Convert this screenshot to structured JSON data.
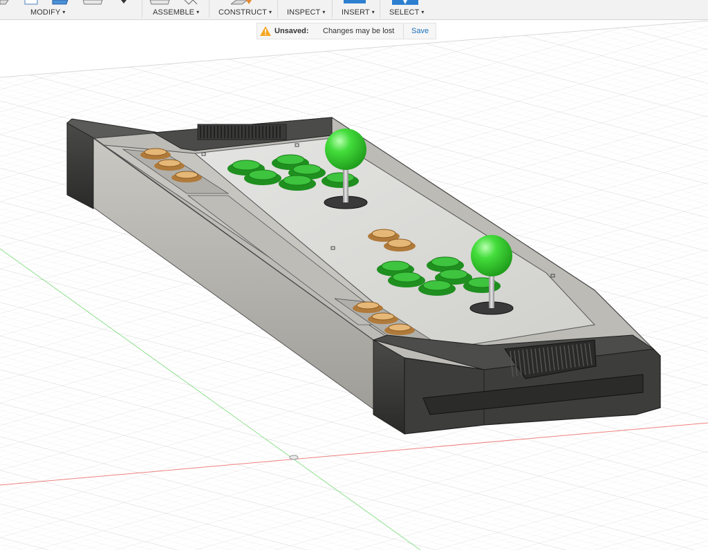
{
  "toolbar": {
    "modify": "MODIFY",
    "assemble": "ASSEMBLE",
    "construct": "CONSTRUCT",
    "inspect": "INSPECT",
    "insert": "INSERT",
    "select": "SELECT",
    "caret": "▾"
  },
  "notification": {
    "title": "Unsaved:",
    "message": "Changes may be lost",
    "save_label": "Save",
    "icon": "warning-icon"
  },
  "model": {
    "name": "arcade fight stick enclosure",
    "button_colors": {
      "action": "#3fbf3f",
      "start": "#e0b070",
      "joystick_ball": "#33cc33"
    }
  }
}
